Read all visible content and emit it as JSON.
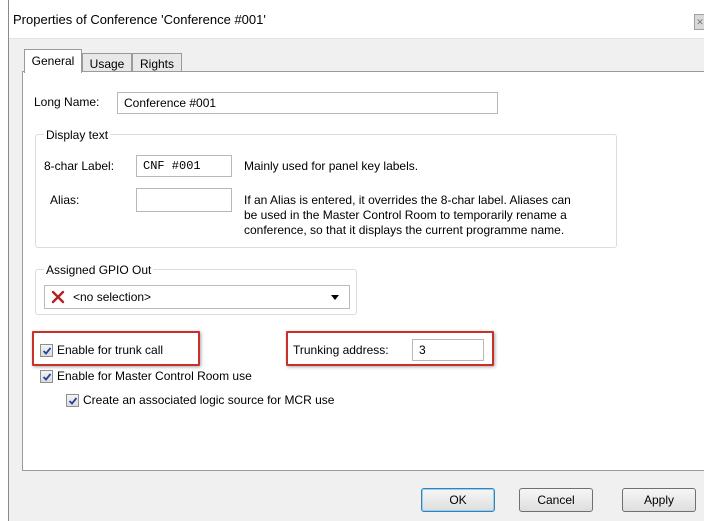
{
  "window": {
    "title": "Properties of Conference 'Conference #001'"
  },
  "tabs": [
    {
      "label": "General",
      "active": true
    },
    {
      "label": "Usage",
      "active": false
    },
    {
      "label": "Rights",
      "active": false
    }
  ],
  "long_name": {
    "label": "Long Name:",
    "value": "Conference #001"
  },
  "display_text": {
    "group_label": "Display text",
    "label_8char": "8-char Label:",
    "value_8char": "CNF #001",
    "hint_8char": "Mainly used for panel key labels.",
    "alias_label": "Alias:",
    "alias_value": "",
    "alias_hint_lines": [
      "If an Alias is entered, it overrides the 8-char label. Aliases can",
      "be used in the Master Control Room to temporarily rename a",
      "conference, so that it displays the current programme name."
    ]
  },
  "gpio": {
    "group_label": "Assigned GPIO Out",
    "selected": "<no selection>",
    "icon": "red-x-icon"
  },
  "options": {
    "trunk_call_label": "Enable for trunk call",
    "trunk_call_checked": true,
    "trunking_address_label": "Trunking address:",
    "trunking_address_value": "3",
    "mcr_label": "Enable for Master Control Room use",
    "mcr_checked": true,
    "logic_source_label": "Create an associated logic source for MCR use",
    "logic_source_checked": true
  },
  "buttons": {
    "ok": "OK",
    "cancel": "Cancel",
    "apply": "Apply"
  },
  "colors": {
    "highlight": "#c9302c",
    "x_icon": "#b22222",
    "default_button_border": "#3c7fb1"
  }
}
